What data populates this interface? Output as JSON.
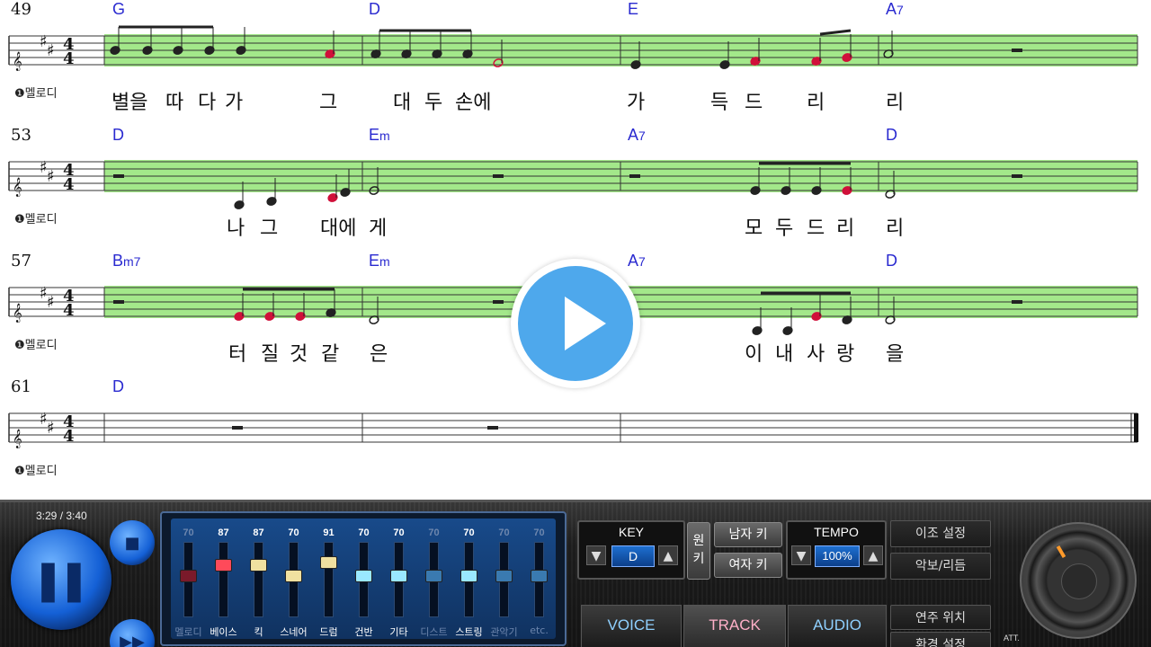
{
  "sheet": {
    "systems": [
      {
        "measure_number": "49",
        "chords": [
          {
            "label": "G"
          },
          {
            "label": "D"
          },
          {
            "label": "E"
          },
          {
            "label": "A7"
          }
        ],
        "lyrics": [
          "별을",
          "따",
          "다",
          "가",
          "그",
          "대",
          "두",
          "손에",
          "가",
          "득",
          "드",
          "리",
          "리"
        ],
        "track_label": "❶멜로디"
      },
      {
        "measure_number": "53",
        "chords": [
          {
            "label": "D"
          },
          {
            "label": "Em"
          },
          {
            "label": "A7"
          },
          {
            "label": "D"
          }
        ],
        "lyrics": [
          "나",
          "그",
          "대에",
          "게",
          "모",
          "두",
          "드",
          "리",
          "리"
        ],
        "track_label": "❶멜로디"
      },
      {
        "measure_number": "57",
        "chords": [
          {
            "label": "Bm7"
          },
          {
            "label": "Em"
          },
          {
            "label": "A7",
            "color": "#e0603a"
          },
          {
            "label": "D"
          }
        ],
        "lyrics": [
          "터",
          "질",
          "것",
          "같",
          "은",
          "이",
          "내",
          "사",
          "랑",
          "을"
        ],
        "track_label": "❶멜로디"
      },
      {
        "measure_number": "61",
        "chords": [
          {
            "label": "D"
          }
        ],
        "lyrics": [],
        "track_label": "❶멜로디"
      }
    ],
    "time_signature": "4/4",
    "key_signature": "D major (2 sharps)",
    "highlight_color": "#a3e88a"
  },
  "player": {
    "time": "3:29 / 3:40",
    "play_pause_icon": "pause-icon",
    "stop_icon": "stop-icon",
    "forward_icon": "fast-forward-icon"
  },
  "mixer": {
    "channels": [
      {
        "name": "멜로디",
        "level": "70",
        "color": "#7a1a2a",
        "active": false
      },
      {
        "name": "베이스",
        "level": "87",
        "color": "#ff4a5a",
        "active": true
      },
      {
        "name": "킥",
        "level": "87",
        "color": "#f0e0a0",
        "active": true
      },
      {
        "name": "스네어",
        "level": "70",
        "color": "#f0e0a0",
        "active": true
      },
      {
        "name": "드럼",
        "level": "91",
        "color": "#f0e0a0",
        "active": true
      },
      {
        "name": "건반",
        "level": "70",
        "color": "#9ae8ff",
        "active": true
      },
      {
        "name": "기타",
        "level": "70",
        "color": "#9ae8ff",
        "active": true
      },
      {
        "name": "디스트",
        "level": "70",
        "color": "#3a7ab0",
        "active": false
      },
      {
        "name": "스트링",
        "level": "70",
        "color": "#9ae8ff",
        "active": true
      },
      {
        "name": "관악기",
        "level": "70",
        "color": "#3a7ab0",
        "active": false
      },
      {
        "name": "etc.",
        "level": "70",
        "color": "#3a7ab0",
        "active": false
      }
    ]
  },
  "controls": {
    "key_label": "KEY",
    "key_value": "D",
    "original_key": "원키",
    "male_key": "남자 키",
    "female_key": "여자 키",
    "tempo_label": "TEMPO",
    "tempo_value": "100%",
    "transpose_settings": "이조 설정",
    "score_rhythm": "악보/리듬",
    "playback_position": "연주 위치",
    "environment_settings": "환경 설정",
    "tab_voice": "VOICE",
    "tab_track": "TRACK",
    "tab_audio": "AUDIO",
    "att_label": "ATT."
  }
}
